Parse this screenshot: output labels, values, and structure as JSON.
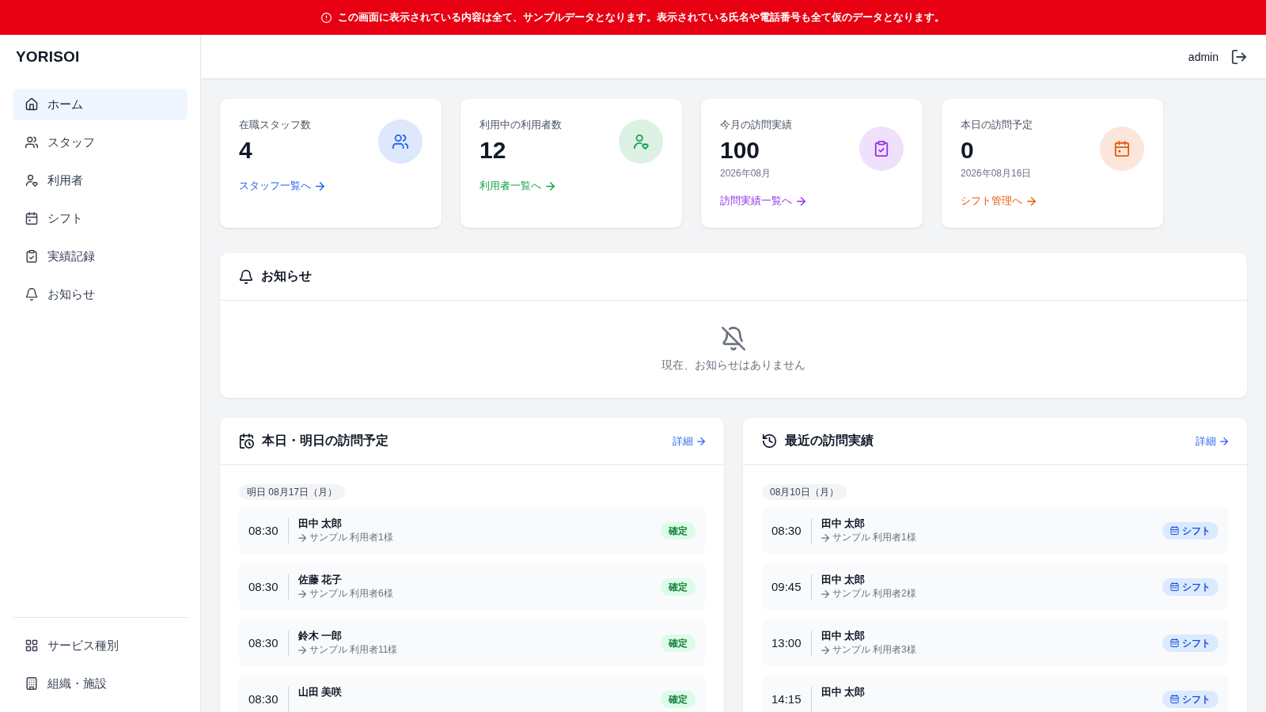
{
  "banner": {
    "text": "この画面に表示されている内容は全て、サンプルデータとなります。表示されている氏名や電話番号も全て仮のデータとなります。"
  },
  "sidebar": {
    "logo": "YORISOI",
    "nav": [
      {
        "label": "ホーム",
        "selected": true
      },
      {
        "label": "スタッフ",
        "selected": false
      },
      {
        "label": "利用者",
        "selected": false
      },
      {
        "label": "シフト",
        "selected": false
      },
      {
        "label": "実績記録",
        "selected": false
      },
      {
        "label": "お知らせ",
        "selected": false
      }
    ],
    "footer_nav": [
      {
        "label": "サービス種別",
        "selected": false
      },
      {
        "label": "組織・施設",
        "selected": false
      }
    ]
  },
  "header": {
    "user": "admin"
  },
  "stats": [
    {
      "label": "在職スタッフ数",
      "value": "4",
      "link": "スタッフ一覧へ",
      "color": "#2563eb"
    },
    {
      "label": "利用中の利用者数",
      "value": "12",
      "link": "利用者一覧へ",
      "color": "#16a34a"
    },
    {
      "label": "今月の訪問実績",
      "value": "100",
      "note": "2026年08月",
      "link": "訪問実績一覧へ",
      "color": "#9333ea"
    },
    {
      "label": "本日の訪問予定",
      "value": "0",
      "note": "2026年08月16日",
      "link": "シフト管理へ",
      "color": "#ea580c"
    }
  ],
  "notices": {
    "title": "お知らせ",
    "empty_message": "現在、お知らせはありません"
  },
  "panels": [
    {
      "title": "本日・明日の訪問予定",
      "link": "詳細",
      "groups": [
        {
          "date": "明日 08月17日（月）",
          "visits": [
            {
              "time": "08:30",
              "staff": "田中 太郎",
              "client": "サンプル 利用者1様",
              "status": {
                "kind": "confirmed",
                "label": "確定"
              }
            },
            {
              "time": "08:30",
              "staff": "佐藤 花子",
              "client": "サンプル 利用者6様",
              "status": {
                "kind": "confirmed",
                "label": "確定"
              }
            },
            {
              "time": "08:30",
              "staff": "鈴木 一郎",
              "client": "サンプル 利用者11様",
              "status": {
                "kind": "confirmed",
                "label": "確定"
              }
            },
            {
              "time": "08:30",
              "staff": "山田 美咲",
              "status": {
                "kind": "confirmed",
                "label": "確定"
              }
            }
          ]
        }
      ]
    },
    {
      "title": "最近の訪問実績",
      "link": "詳細",
      "groups": [
        {
          "date": "08月10日（月）",
          "visits": [
            {
              "time": "08:30",
              "staff": "田中 太郎",
              "client": "サンプル 利用者1様",
              "status": {
                "kind": "shift",
                "label": "シフト"
              }
            },
            {
              "time": "09:45",
              "staff": "田中 太郎",
              "client": "サンプル 利用者2様",
              "status": {
                "kind": "shift",
                "label": "シフト"
              }
            },
            {
              "time": "13:00",
              "staff": "田中 太郎",
              "client": "サンプル 利用者3様",
              "status": {
                "kind": "shift",
                "label": "シフト"
              }
            },
            {
              "time": "14:15",
              "staff": "田中 太郎",
              "status": {
                "kind": "shift",
                "label": "シフト"
              }
            }
          ]
        }
      ]
    }
  ]
}
